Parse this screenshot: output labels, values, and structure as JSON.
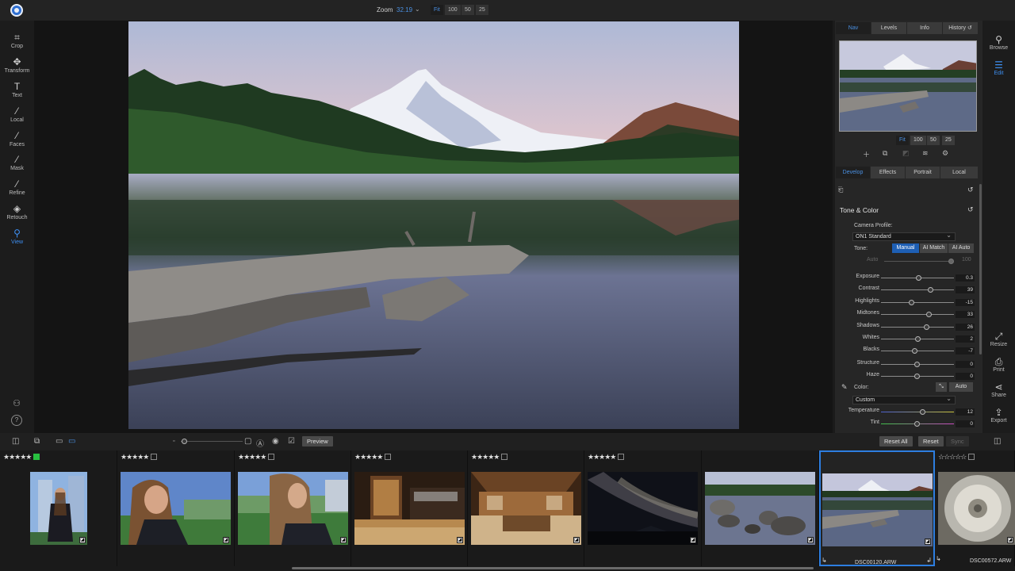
{
  "topbar": {
    "zoom_label": "Zoom",
    "zoom_value": "32.19",
    "zoom_options": [
      "Fit",
      "100",
      "50",
      "25"
    ]
  },
  "left_tools": [
    {
      "label": "Crop",
      "icon": "crop-icon",
      "glyph": "⌗"
    },
    {
      "label": "Transform",
      "icon": "move-icon",
      "glyph": "✥"
    },
    {
      "label": "Text",
      "icon": "text-icon",
      "glyph": "T"
    },
    {
      "label": "Local",
      "icon": "brush-icon",
      "glyph": "⁄"
    },
    {
      "label": "Faces",
      "icon": "faces-icon",
      "glyph": "⁄"
    },
    {
      "label": "Mask",
      "icon": "mask-icon",
      "glyph": "⁄"
    },
    {
      "label": "Refine",
      "icon": "refine-icon",
      "glyph": "⁄"
    },
    {
      "label": "Retouch",
      "icon": "retouch-icon",
      "glyph": "◈"
    },
    {
      "label": "View",
      "icon": "view-icon",
      "glyph": "⚲"
    }
  ],
  "right_panel": {
    "tabs": [
      "Nav",
      "Levels",
      "Info",
      "History"
    ],
    "nav_zoom": [
      "Fit",
      "100",
      "50",
      "25"
    ],
    "develop_tabs": [
      "Develop",
      "Effects",
      "Portrait",
      "Local"
    ],
    "section_title": "Tone & Color",
    "camera_profile_label": "Camera Profile:",
    "camera_profile_value": "ON1 Standard",
    "tone_label": "Tone:",
    "tone_modes": [
      "Manual",
      "AI Match",
      "AI Auto"
    ],
    "auto_label": "Auto",
    "auto_value": "100",
    "sliders": [
      {
        "label": "Exposure",
        "value": "0.3",
        "pos": 0.52
      },
      {
        "label": "Contrast",
        "value": "39",
        "pos": 0.68
      },
      {
        "label": "Highlights",
        "value": "-15",
        "pos": 0.42
      },
      {
        "label": "Midtones",
        "value": "33",
        "pos": 0.66
      },
      {
        "label": "Shadows",
        "value": "26",
        "pos": 0.63
      },
      {
        "label": "Whites",
        "value": "2",
        "pos": 0.51
      },
      {
        "label": "Blacks",
        "value": "-7",
        "pos": 0.47
      },
      {
        "label": "Structure",
        "value": "0",
        "pos": 0.5
      },
      {
        "label": "Haze",
        "value": "0",
        "pos": 0.5
      }
    ],
    "color_label": "Color:",
    "color_auto": "Auto",
    "color_preset": "Custom",
    "color_sliders": [
      {
        "label": "Temperature",
        "value": "12",
        "pos": 0.58
      },
      {
        "label": "Tint",
        "value": "0",
        "pos": 0.5
      }
    ]
  },
  "far_right": [
    {
      "label": "Browse",
      "icon": "browse-icon",
      "glyph": "⚲"
    },
    {
      "label": "Edit",
      "icon": "edit-sliders-icon",
      "glyph": "☰"
    },
    {
      "label": "Resize",
      "icon": "resize-icon",
      "glyph": "⤢"
    },
    {
      "label": "Print",
      "icon": "print-icon",
      "glyph": "⎙"
    },
    {
      "label": "Share",
      "icon": "share-icon",
      "glyph": "⋖"
    },
    {
      "label": "Export",
      "icon": "export-icon",
      "glyph": "⇪"
    }
  ],
  "filmbar": {
    "preview": "Preview",
    "reset_all": "Reset All",
    "reset": "Reset",
    "sync": "Sync"
  },
  "filmstrip": [
    {
      "stars": "★★★★★",
      "flag": "green",
      "thumb": "portrait-city",
      "filename": ""
    },
    {
      "stars": "★★★★★",
      "flag": "box",
      "thumb": "portrait-park",
      "filename": ""
    },
    {
      "stars": "★★★★★",
      "flag": "box",
      "thumb": "portrait-park-side",
      "filename": ""
    },
    {
      "stars": "★★★★★",
      "flag": "box",
      "thumb": "bar-interior",
      "filename": ""
    },
    {
      "stars": "★★★★★",
      "flag": "box",
      "thumb": "restaurant-interior",
      "filename": ""
    },
    {
      "stars": "★★★★★",
      "flag": "box",
      "thumb": "milky-way",
      "filename": ""
    },
    {
      "stars": "",
      "flag": "none",
      "thumb": "lake-rocks",
      "filename": ""
    },
    {
      "stars": "",
      "flag": "none",
      "thumb": "lake-mountain",
      "filename": "DSC00120.ARW"
    },
    {
      "stars": "☆☆☆☆☆",
      "flag": "box",
      "thumb": "dandelion",
      "filename": "DSC00572.ARW"
    }
  ]
}
